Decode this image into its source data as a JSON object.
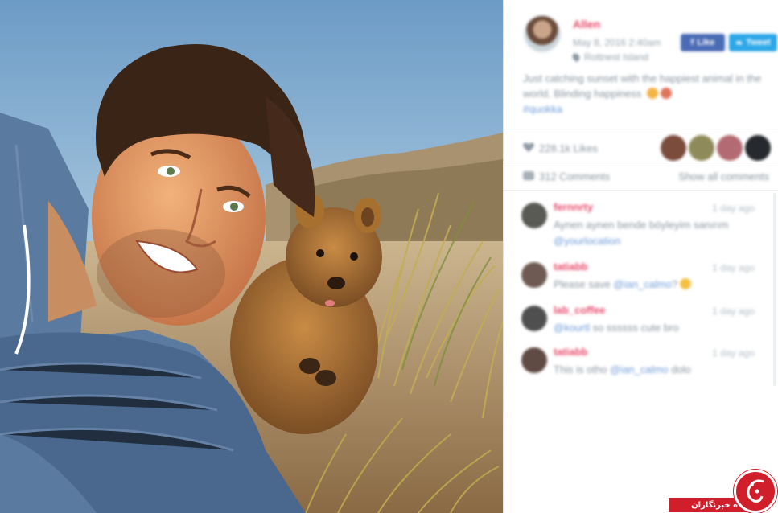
{
  "photo": {
    "subject": "selfie of smiling man with a quokka on grassy dunes at sunset",
    "colors": {
      "sky": "#7ea9d0",
      "fur": "#a06a34",
      "sweater": "#5f7ea3",
      "hair": "#3a2416",
      "grass": "#b7a24a"
    }
  },
  "post": {
    "username": "Allen",
    "date": "May 8, 2016 2:40am",
    "location": "Rottnest Island",
    "facebook_label": "Like",
    "twitter_label": "Tweet",
    "caption_text": "Just catching sunset with the happiest animal in the world. Blinding happiness",
    "hashtag": "#quokka"
  },
  "likes": {
    "text": "228.1k Likes",
    "liker_colors": [
      "#7b4b3c",
      "#8f8a5a",
      "#b46a72",
      "#26292e"
    ]
  },
  "comments_bar": {
    "count_text": "312 Comments",
    "show_all_label": "Show all comments"
  },
  "comments": [
    {
      "user": "fernnrty",
      "time": "1 day ago",
      "text": "Aynen aynen bende böyleyim sanırım",
      "mention": "@yourlocation",
      "avatar_color": "#5a5a55"
    },
    {
      "user": "tatiabb",
      "time": "1 day ago",
      "text": "Please save",
      "mention": "@ian_calmo",
      "trailing": "?",
      "avatar_color": "#6e5a52"
    },
    {
      "user": "lab_coffee",
      "time": "1 day ago",
      "text": "so ssssss cute bro",
      "mention": "@kourtl",
      "avatar_color": "#4f4f50"
    },
    {
      "user": "tatiabb",
      "time": "1 day ago",
      "text": "This is otho",
      "mention": "@ian_calmo",
      "trailing": "dolo",
      "avatar_color": "#5f4a44"
    }
  ],
  "watermark": {
    "text": "باشگاه خبرنگاران",
    "color": "#d01f2a"
  }
}
